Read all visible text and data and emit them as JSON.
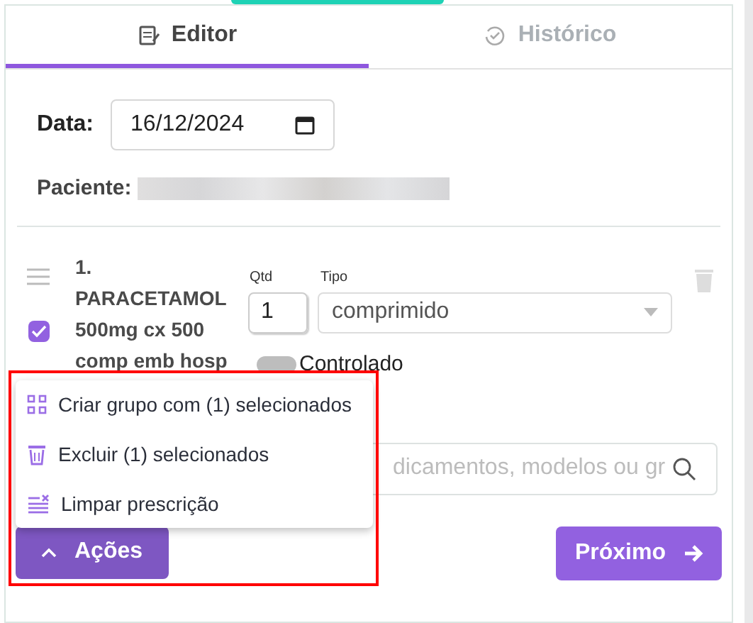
{
  "tabs": [
    {
      "label": "Editor",
      "selected": true
    },
    {
      "label": "Histórico",
      "selected": false
    }
  ],
  "date": {
    "label": "Data:",
    "value": "16/12/2024"
  },
  "patient": {
    "label": "Paciente:"
  },
  "items": [
    {
      "name": "1. PARACETAMOL 500mg cx 500 comp emb hosp",
      "checked": true,
      "qty_label": "Qtd",
      "qty": "1",
      "type_label": "Tipo",
      "type": "comprimido",
      "controlled_label": "Controlado",
      "controlled": false
    }
  ],
  "search": {
    "placeholder": "dicamentos, modelos ou gr"
  },
  "actions_menu": {
    "expanded": true,
    "items": [
      {
        "label": "Criar grupo com (1) selecionados"
      },
      {
        "label": "Excluir (1) selecionados"
      },
      {
        "label": "Limpar prescrição"
      }
    ]
  },
  "actions_button": "Ações",
  "next_button": "Próximo"
}
